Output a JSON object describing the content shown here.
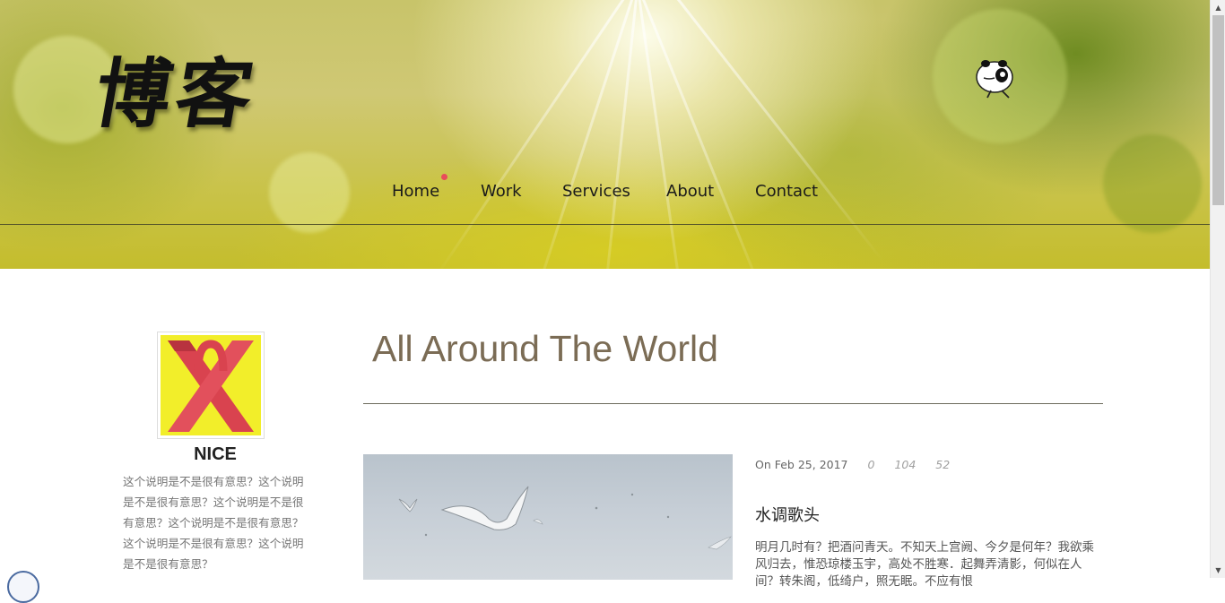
{
  "header": {
    "logo_text": "博客",
    "nav": [
      {
        "label": "Home",
        "active": true
      },
      {
        "label": "Work",
        "active": false
      },
      {
        "label": "Services",
        "active": false
      },
      {
        "label": "About",
        "active": false
      },
      {
        "label": "Contact",
        "active": false
      }
    ]
  },
  "sidebar": {
    "profile_name": "NICE",
    "profile_description": "这个说明是不是很有意思？这个说明是不是很有意思？这个说明是不是很有意思？这个说明是不是很有意思？这个说明是不是很有意思？这个说明是不是很有意思？"
  },
  "main": {
    "page_title": "All Around The World",
    "post": {
      "date": "On Feb 25, 2017",
      "stats": [
        "0",
        "104",
        "52"
      ],
      "title": "水调歌头",
      "excerpt": "明月几时有？把酒问青天。不知天上宫阙、今夕是何年？我欲乘风归去，惟恐琼楼玉宇，高处不胜寒．起舞弄清影，何似在人间？转朱阁，低绮户，照无眠。不应有恨"
    }
  },
  "colors": {
    "accent_dot": "#e84c5a",
    "title": "#7b6c55",
    "avatar_bg": "#f2ee2a",
    "avatar_mark": "#d9434f"
  },
  "icons": {
    "mascot": "panda-mascot-icon",
    "scroll_up": "arrow-up-icon",
    "scroll_down": "arrow-down-icon"
  }
}
